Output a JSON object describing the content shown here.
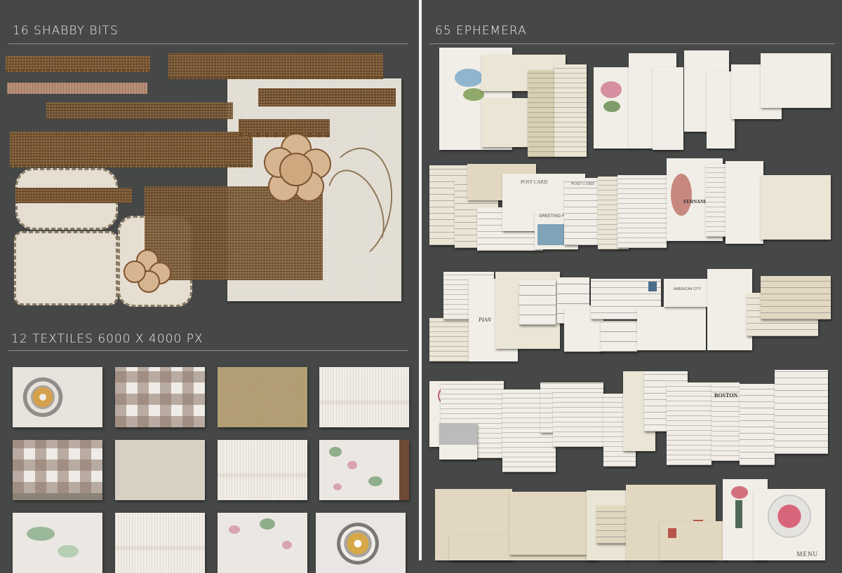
{
  "left_panel": {
    "shabby_heading": "16 SHABBY BITS",
    "textiles_heading": "12 TEXTILES 6000 X 4000 PX",
    "textile_tiles": [
      {
        "pattern": "suzani-medallion",
        "color": "#e8e3dc"
      },
      {
        "pattern": "gingham-check",
        "color": "#efebe6"
      },
      {
        "pattern": "linen",
        "color": "#b59f74"
      },
      {
        "pattern": "chenille-stripe",
        "color": "#f1ede6"
      },
      {
        "pattern": "gingham-check-fringe",
        "color": "#efebe6"
      },
      {
        "pattern": "plain-canvas",
        "color": "#d8d0c2"
      },
      {
        "pattern": "chenille-stripe",
        "color": "#f1ede6"
      },
      {
        "pattern": "floral",
        "color": "#ebe8e3"
      },
      {
        "pattern": "floral",
        "color": "#ebe8e3"
      },
      {
        "pattern": "chenille-stripe",
        "color": "#f1ede6"
      },
      {
        "pattern": "floral",
        "color": "#ebe8e3"
      },
      {
        "pattern": "damask-medallion",
        "color": "#e9e6e3"
      }
    ]
  },
  "right_panel": {
    "ephemera_heading": "65 EPHEMERA",
    "card_texts": {
      "post_card": "POST CARD",
      "post_card_2": "POST CARD",
      "greetings": "GREETING FR",
      "fernand": "FERNAND RO",
      "boston": "BOSTON",
      "menu": "MENU",
      "amer_city": "AMERICAN CITY",
      "pianos": "PIAN"
    }
  },
  "colors": {
    "background": "#464847",
    "divider": "#f3f3f1",
    "heading_text": "#eeeeea",
    "burlap": "#7b5a37",
    "canvas": "#e9e4da"
  }
}
